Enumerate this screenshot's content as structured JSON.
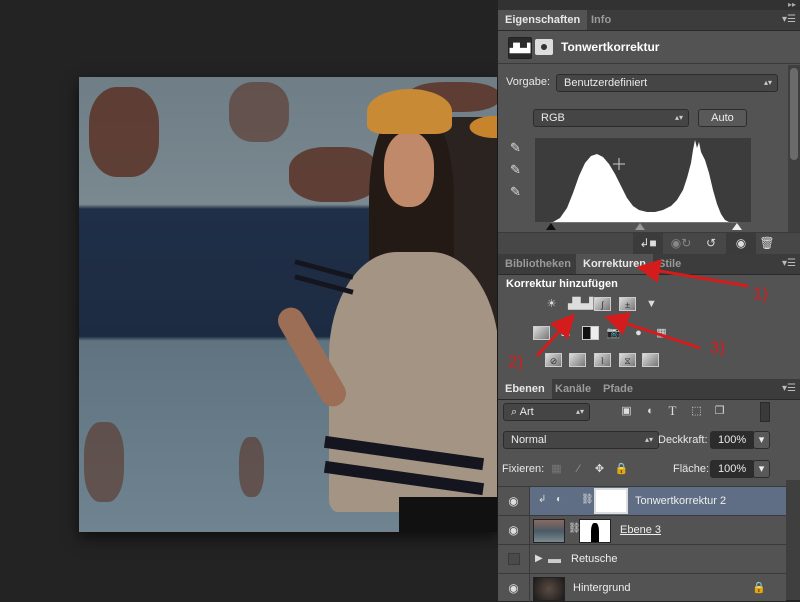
{
  "canvas": {
    "description": "Photo of woman in orange cap and glitter t-shirt in front of rusty blue wall"
  },
  "properties_panel": {
    "tabs": [
      {
        "label": "Eigenschaften",
        "active": true
      },
      {
        "label": "Info",
        "active": false
      }
    ],
    "adjustment_title": "Tonwertkorrektur",
    "preset_label": "Vorgabe:",
    "preset_value": "Benutzerdefiniert",
    "channel_value": "RGB",
    "auto_button": "Auto",
    "histogram": {
      "input_black": 0,
      "input_gray": 1.0,
      "input_white": 255
    }
  },
  "adjustments_panel": {
    "tabs": [
      {
        "label": "Bibliotheken",
        "active": false
      },
      {
        "label": "Korrekturen",
        "active": true
      },
      {
        "label": "Stile",
        "active": false
      }
    ],
    "title": "Korrektur hinzufügen",
    "row1": [
      "brightness-contrast",
      "levels",
      "curves",
      "exposure",
      "vibrance"
    ],
    "row2": [
      "hue-saturation",
      "color-balance",
      "black-white",
      "photo-filter",
      "channel-mixer",
      "color-lookup"
    ],
    "row3": [
      "invert",
      "posterize",
      "threshold",
      "selective-color",
      "gradient-map"
    ]
  },
  "layers_panel": {
    "tabs": [
      {
        "label": "Ebenen",
        "active": true
      },
      {
        "label": "Kanäle",
        "active": false
      },
      {
        "label": "Pfade",
        "active": false
      }
    ],
    "filter_kind": "Art",
    "blend_mode": "Normal",
    "opacity_label": "Deckkraft:",
    "opacity_value": "100%",
    "lock_label": "Fixieren:",
    "fill_label": "Fläche:",
    "fill_value": "100%",
    "layers": [
      {
        "name": "Tonwertkorrektur 2",
        "visible": true,
        "selected": true,
        "type": "adjustment"
      },
      {
        "name": "Ebene 3",
        "visible": true,
        "selected": false,
        "type": "pixel-with-mask"
      },
      {
        "name": "Retusche",
        "visible": false,
        "selected": false,
        "type": "group"
      },
      {
        "name": "Hintergrund",
        "visible": true,
        "selected": false,
        "type": "background",
        "locked": true
      }
    ]
  },
  "annotations": {
    "labels": [
      "1)",
      "2)",
      "3)"
    ],
    "color": "#d41c1c"
  }
}
